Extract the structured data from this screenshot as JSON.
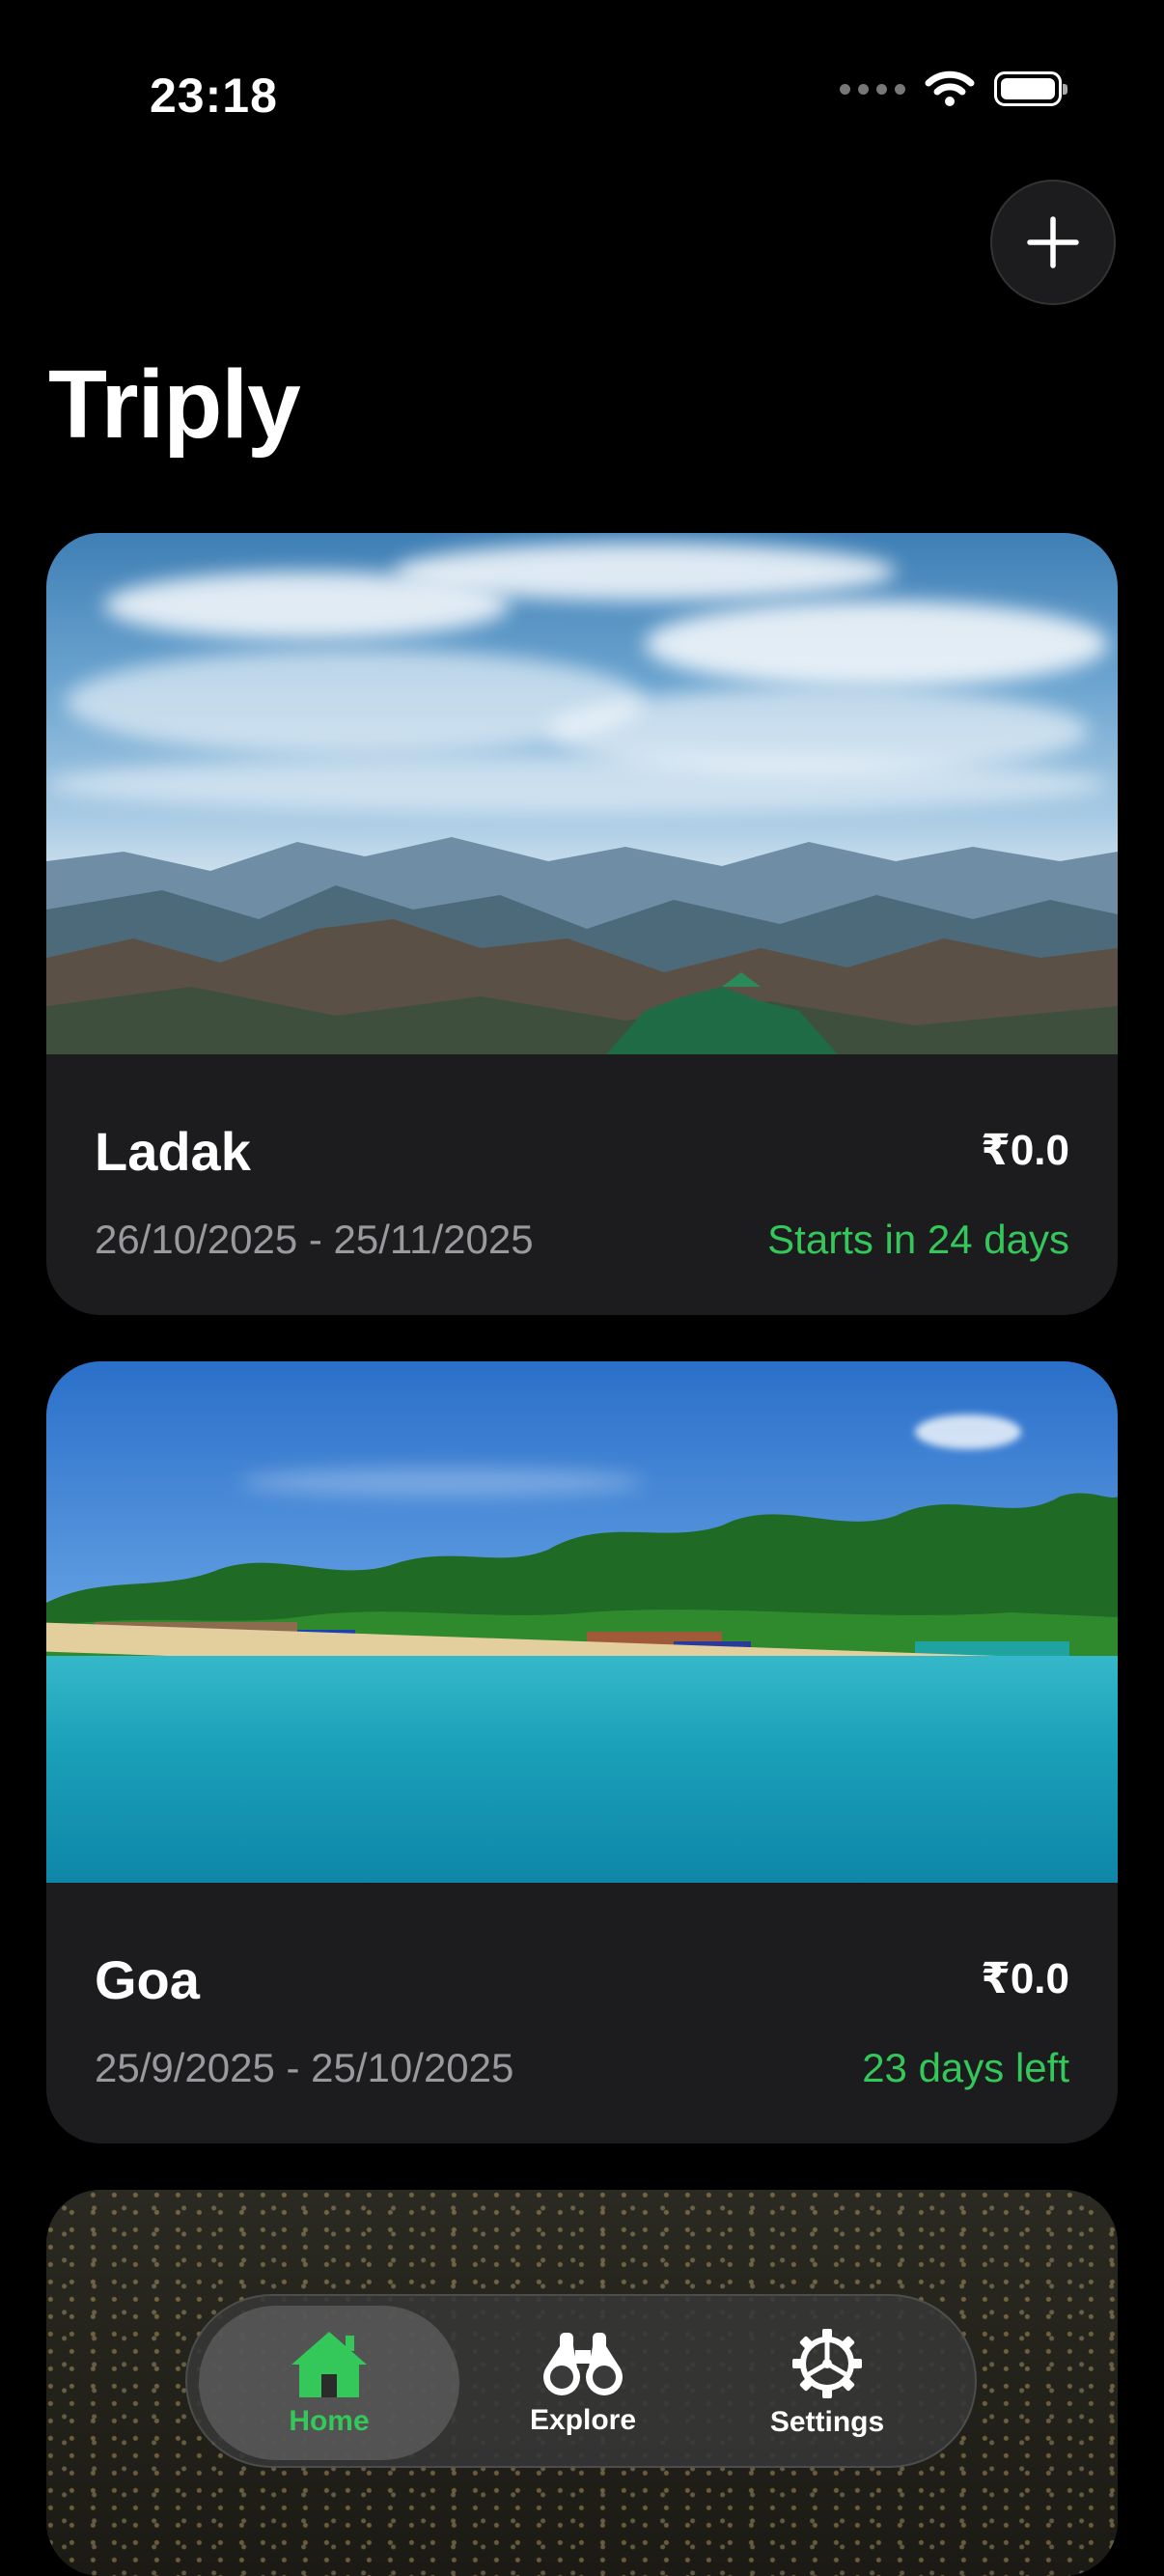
{
  "status_bar": {
    "time": "23:18"
  },
  "header": {
    "title": "Triply"
  },
  "colors": {
    "accent": "#34c759",
    "card_bg": "#1c1c1e",
    "muted": "#9a9a9e"
  },
  "trips": [
    {
      "name": "Ladak",
      "cost": "₹0.0",
      "dates": "26/10/2025 - 25/11/2025",
      "status": "Starts in 24 days"
    },
    {
      "name": "Goa",
      "cost": "₹0.0",
      "dates": "25/9/2025 - 25/10/2025",
      "status": "23 days left"
    }
  ],
  "tab_bar": {
    "selected": "Home",
    "items": [
      {
        "label": "Home",
        "icon": "house-icon"
      },
      {
        "label": "Explore",
        "icon": "binoculars-icon"
      },
      {
        "label": "Settings",
        "icon": "gear-icon"
      }
    ]
  }
}
